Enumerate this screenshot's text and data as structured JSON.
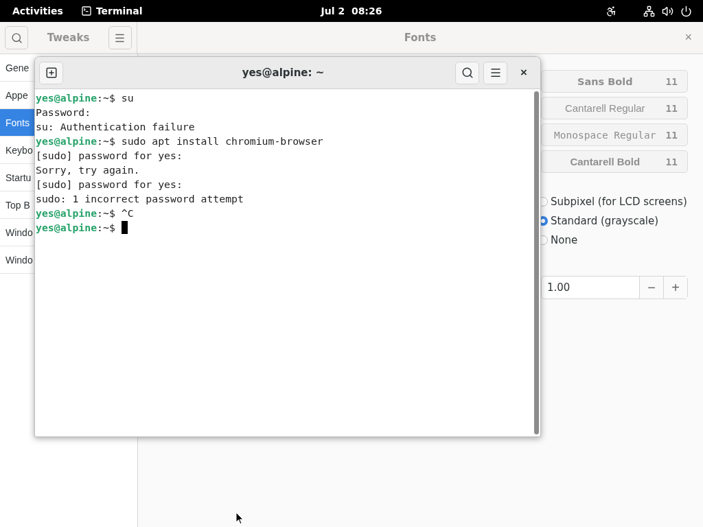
{
  "top_bar": {
    "activities": "Activities",
    "app": "Terminal",
    "clock": "Jul 2  08:26"
  },
  "tweaks": {
    "title": "Tweaks",
    "page_title": "Fonts",
    "sidebar": [
      {
        "label": "Gene",
        "selected": false
      },
      {
        "label": "Appe",
        "selected": false
      },
      {
        "label": "Fonts",
        "selected": true
      },
      {
        "label": "Keybo",
        "selected": false
      },
      {
        "label": "Startu",
        "selected": false
      },
      {
        "label": "Top B",
        "selected": false
      },
      {
        "label": "Windo",
        "selected": false
      },
      {
        "label": "Windo",
        "selected": false
      }
    ],
    "fonts": [
      {
        "name": "Sans Bold",
        "size": "11",
        "kind": "sans-bold"
      },
      {
        "name": "Cantarell Regular",
        "size": "11",
        "kind": "regular"
      },
      {
        "name": "Monospace Regular",
        "size": "11",
        "kind": "mono"
      },
      {
        "name": "Cantarell Bold",
        "size": "11",
        "kind": "bold"
      }
    ],
    "antialiasing": [
      {
        "label": "Subpixel (for LCD screens)",
        "selected": false
      },
      {
        "label": "Standard (grayscale)",
        "selected": true
      },
      {
        "label": "None",
        "selected": false
      }
    ],
    "scaling": {
      "value": "1.00",
      "minus": "−",
      "plus": "+"
    }
  },
  "terminal": {
    "title": "yes@alpine: ~",
    "close": "×",
    "lines": [
      {
        "kind": "prompt",
        "user": "yes@alpine",
        "text": ":~$ su"
      },
      {
        "kind": "output",
        "text": "Password:"
      },
      {
        "kind": "output",
        "text": "su: Authentication failure"
      },
      {
        "kind": "prompt",
        "user": "yes@alpine",
        "text": ":~$ sudo apt install chromium-browser"
      },
      {
        "kind": "output",
        "text": "[sudo] password for yes:"
      },
      {
        "kind": "output",
        "text": "Sorry, try again."
      },
      {
        "kind": "output",
        "text": "[sudo] password for yes:"
      },
      {
        "kind": "output",
        "text": "sudo: 1 incorrect password attempt"
      },
      {
        "kind": "prompt",
        "user": "yes@alpine",
        "text": ":~$ ^C"
      },
      {
        "kind": "prompt",
        "user": "yes@alpine",
        "text": ":~$ ",
        "cursor": true
      }
    ]
  },
  "tweaks_close": "×"
}
